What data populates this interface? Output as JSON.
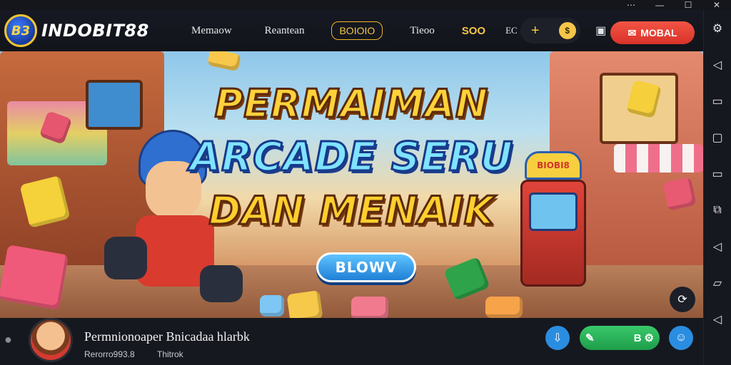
{
  "brand": {
    "logo_initials": "B3",
    "name": "INDOBIT88"
  },
  "nav": {
    "items": [
      "Memaow",
      "Reantean",
      "Tieoo"
    ],
    "pill_label": "BOIOIO",
    "gold_label": "SOO",
    "extra_label": "EC",
    "login_label": "MOBAL"
  },
  "hero": {
    "line1": "PERMAIMAN",
    "line2": "ARCADE SERU",
    "line3": "DAN MENAIK",
    "cabinet_label": "BIOBI8",
    "button_label": "BLOWV"
  },
  "bottom": {
    "title": "Permnionoaper Bnicadaa hlarbk",
    "sub1": "Rerorro993.8",
    "sub2": "Thitrok",
    "pill_text": "B"
  },
  "colors": {
    "accent_gold": "#f6c64a",
    "login_red": "#e2392e",
    "play_green": "#2bb559",
    "info_blue": "#2a8de0"
  }
}
